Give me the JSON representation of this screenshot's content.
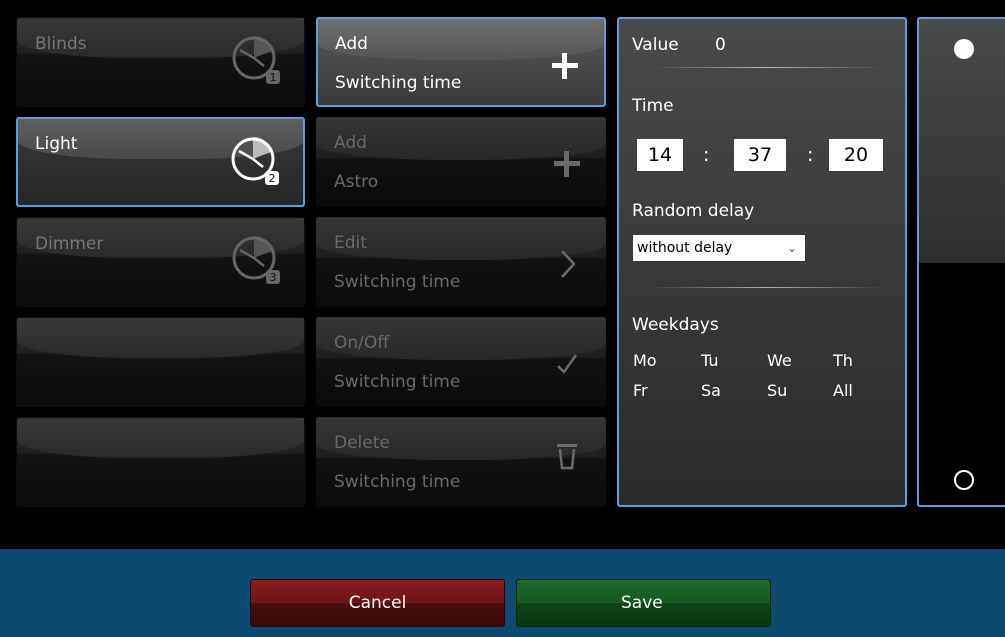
{
  "channels": [
    {
      "label": "Blinds",
      "badge": "1",
      "selected": false
    },
    {
      "label": "Light",
      "badge": "2",
      "selected": true
    },
    {
      "label": "Dimmer",
      "badge": "3",
      "selected": false
    },
    {
      "label": "",
      "badge": "",
      "selected": false
    },
    {
      "label": "",
      "badge": "",
      "selected": false
    }
  ],
  "actions": [
    {
      "line1": "Add",
      "line2": "Switching time",
      "icon": "plus-icon",
      "enabled": true
    },
    {
      "line1": "Add",
      "line2": "Astro",
      "icon": "plus-icon",
      "enabled": false
    },
    {
      "line1": "Edit",
      "line2": "Switching time",
      "icon": "chevron-right-icon",
      "enabled": false
    },
    {
      "line1": "On/Off",
      "line2": "Switching time",
      "icon": "check-icon",
      "enabled": false
    },
    {
      "line1": "Delete",
      "line2": "Switching time",
      "icon": "trash-icon",
      "enabled": false
    }
  ],
  "panel": {
    "value_label": "Value",
    "value": "0",
    "time_label": "Time",
    "hours": "14",
    "minutes": "37",
    "seconds": "20",
    "colon": ":",
    "random_delay_label": "Random delay",
    "random_delay_value": "without delay",
    "weekdays_label": "Weekdays",
    "weekdays": [
      "Mo",
      "Tu",
      "We",
      "Th",
      "Fr",
      "Sa",
      "Su",
      "All"
    ]
  },
  "footer": {
    "cancel_label": "Cancel",
    "save_label": "Save"
  },
  "colors": {
    "accent_border": "#5a9ee0",
    "footer_bg": "#0c4a72",
    "cancel": "#6e1313",
    "save": "#165a21"
  }
}
